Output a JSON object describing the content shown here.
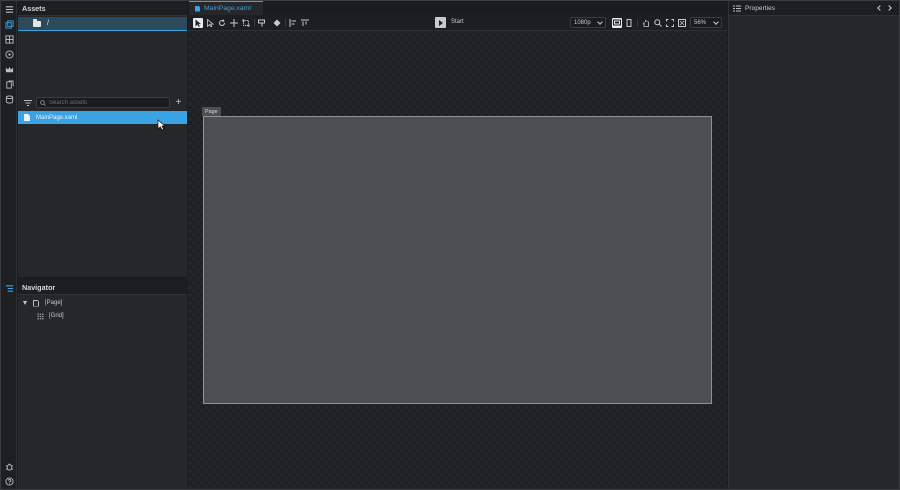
{
  "assets": {
    "title": "Assets",
    "folder": "/",
    "search_placeholder": "Search assets",
    "add_label": "+",
    "file": "MainPage.xaml"
  },
  "navigator": {
    "title": "Navigator",
    "items": [
      {
        "label": "[Page]"
      },
      {
        "label": "[Grid]"
      }
    ]
  },
  "editor": {
    "tab": "MainPage.xaml",
    "start_label": "Start",
    "resolution": "1080p",
    "zoom": "56%",
    "page_tag": "Page"
  },
  "properties": {
    "title": "Properties"
  },
  "colors": {
    "accent": "#3aa3e3",
    "panel": "#25272a",
    "canvas": "#4d5053"
  }
}
